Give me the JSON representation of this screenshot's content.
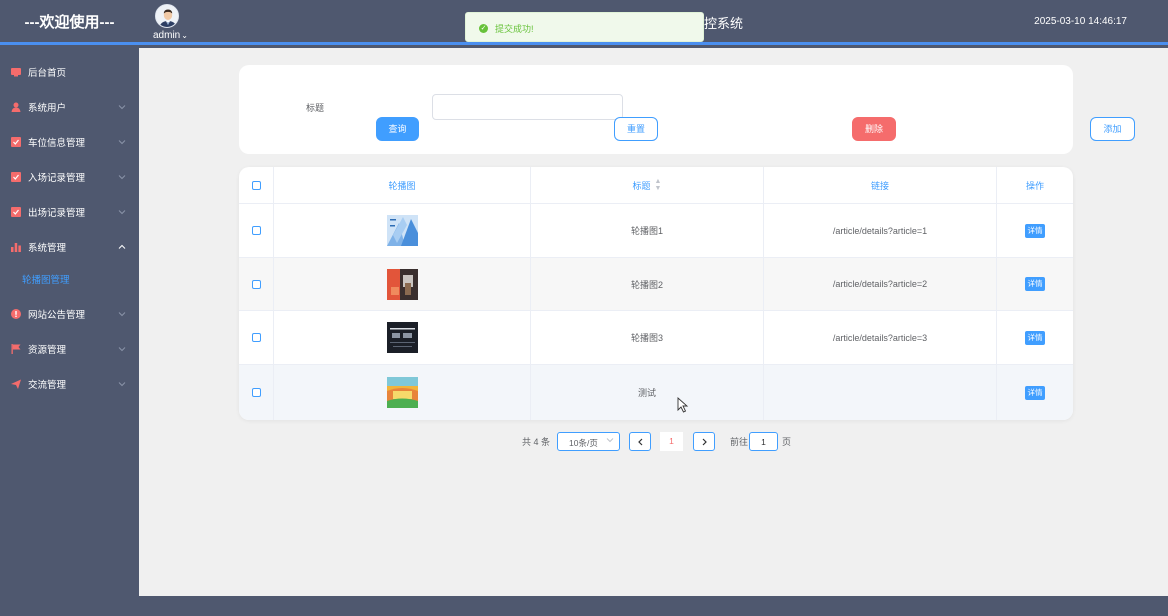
{
  "header": {
    "brand": "---欢迎使用---",
    "user": "admin",
    "system_title_fragment": "控系统",
    "datetime": "2025-03-10 14:46:17"
  },
  "toast": {
    "message": "提交成功!",
    "icon": "success-check-icon",
    "color": "#67c23a"
  },
  "sidebar": {
    "items": [
      {
        "label": "后台首页",
        "icon": "monitor-icon",
        "expandable": false
      },
      {
        "label": "系统用户",
        "icon": "user-icon",
        "expandable": true
      },
      {
        "label": "车位信息管理",
        "icon": "checkbox-icon",
        "expandable": true
      },
      {
        "label": "入场记录管理",
        "icon": "checkbox-icon",
        "expandable": true
      },
      {
        "label": "出场记录管理",
        "icon": "checkbox-icon",
        "expandable": true
      },
      {
        "label": "系统管理",
        "icon": "bar-chart-icon",
        "expandable": true,
        "expanded": true,
        "children": [
          {
            "label": "轮播图管理",
            "active": true
          }
        ]
      },
      {
        "label": "网站公告管理",
        "icon": "info-icon",
        "expandable": true
      },
      {
        "label": "资源管理",
        "icon": "flag-icon",
        "expandable": true
      },
      {
        "label": "交流管理",
        "icon": "send-icon",
        "expandable": true
      }
    ]
  },
  "search": {
    "title_label": "标题",
    "title_value": "",
    "buttons": {
      "query": "查询",
      "reset": "重置",
      "delete": "删除",
      "add": "添加"
    }
  },
  "table": {
    "headers": {
      "image": "轮播图",
      "title": "标题",
      "link": "链接",
      "actions": "操作"
    },
    "rows": [
      {
        "title": "轮播图1",
        "link": "/article/details?article=1",
        "action": "详情"
      },
      {
        "title": "轮播图2",
        "link": "/article/details?article=2",
        "action": "详情"
      },
      {
        "title": "轮播图3",
        "link": "/article/details?article=3",
        "action": "详情"
      },
      {
        "title": "测试",
        "link": "",
        "action": "详情"
      }
    ]
  },
  "pagination": {
    "total": "共 4 条",
    "page_size": "10条/页",
    "current_page": "1",
    "goto_label": "前往",
    "goto_value": "1",
    "page_suffix": "页"
  },
  "colors": {
    "primary": "#409eff",
    "danger": "#f56c6c",
    "sidebar_bg": "#4f586f",
    "content_bg": "#f0f0f0"
  }
}
